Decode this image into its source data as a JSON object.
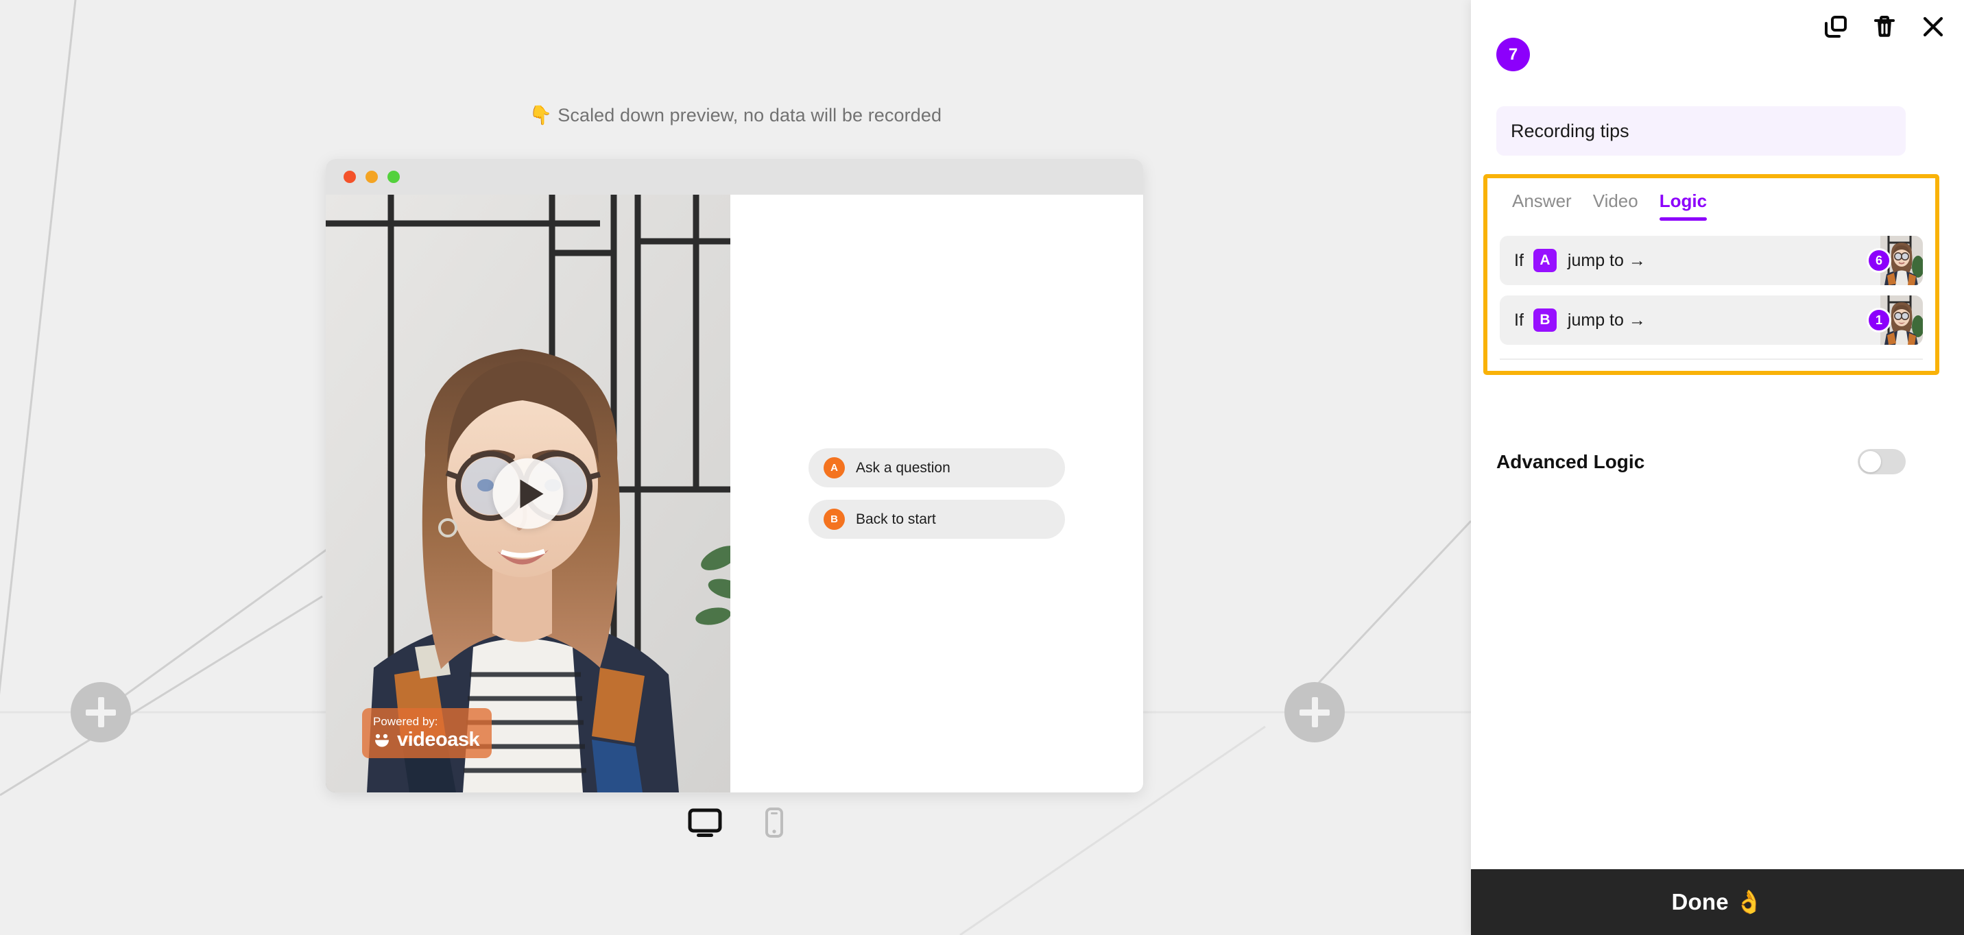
{
  "canvas": {
    "preview_notice": "👇 Scaled down preview, no data will be recorded",
    "add_node_left_label": "+",
    "add_node_right_label": "+"
  },
  "preview": {
    "window_dots": [
      "red",
      "yellow",
      "green"
    ],
    "play_button": "play-icon",
    "watermark": {
      "powered_by": "Powered by:",
      "brand": "videoask"
    },
    "answers": [
      {
        "letter": "A",
        "label": "Ask a question"
      },
      {
        "letter": "B",
        "label": "Back to start"
      }
    ],
    "devices": [
      {
        "name": "desktop",
        "active": true
      },
      {
        "name": "mobile",
        "active": false
      }
    ]
  },
  "panel": {
    "step_number": "7",
    "icons": {
      "duplicate": "duplicate-icon",
      "delete": "trash-icon",
      "close": "close-icon"
    },
    "title": {
      "value": "Recording tips",
      "placeholder": "Add a title"
    },
    "tabs": [
      {
        "label": "Answer",
        "active": false
      },
      {
        "label": "Video",
        "active": false
      },
      {
        "label": "Logic",
        "active": true
      }
    ],
    "logic_rows": [
      {
        "if_label": "If",
        "letter": "A",
        "action": "jump to →",
        "target": "6"
      },
      {
        "if_label": "If",
        "letter": "B",
        "action": "jump to →",
        "target": "1"
      }
    ],
    "advanced_logic": {
      "label": "Advanced Logic",
      "enabled": false
    },
    "done_button": "Done 👌"
  },
  "colors": {
    "accent_purple": "#8c00fb",
    "letter_purple": "#9710ff",
    "highlight_yellow": "#f9b208",
    "answer_orange": "#f4731f",
    "done_bar": "#262626",
    "title_bg": "#f7f2fe",
    "canvas_bg": "#efefef"
  }
}
